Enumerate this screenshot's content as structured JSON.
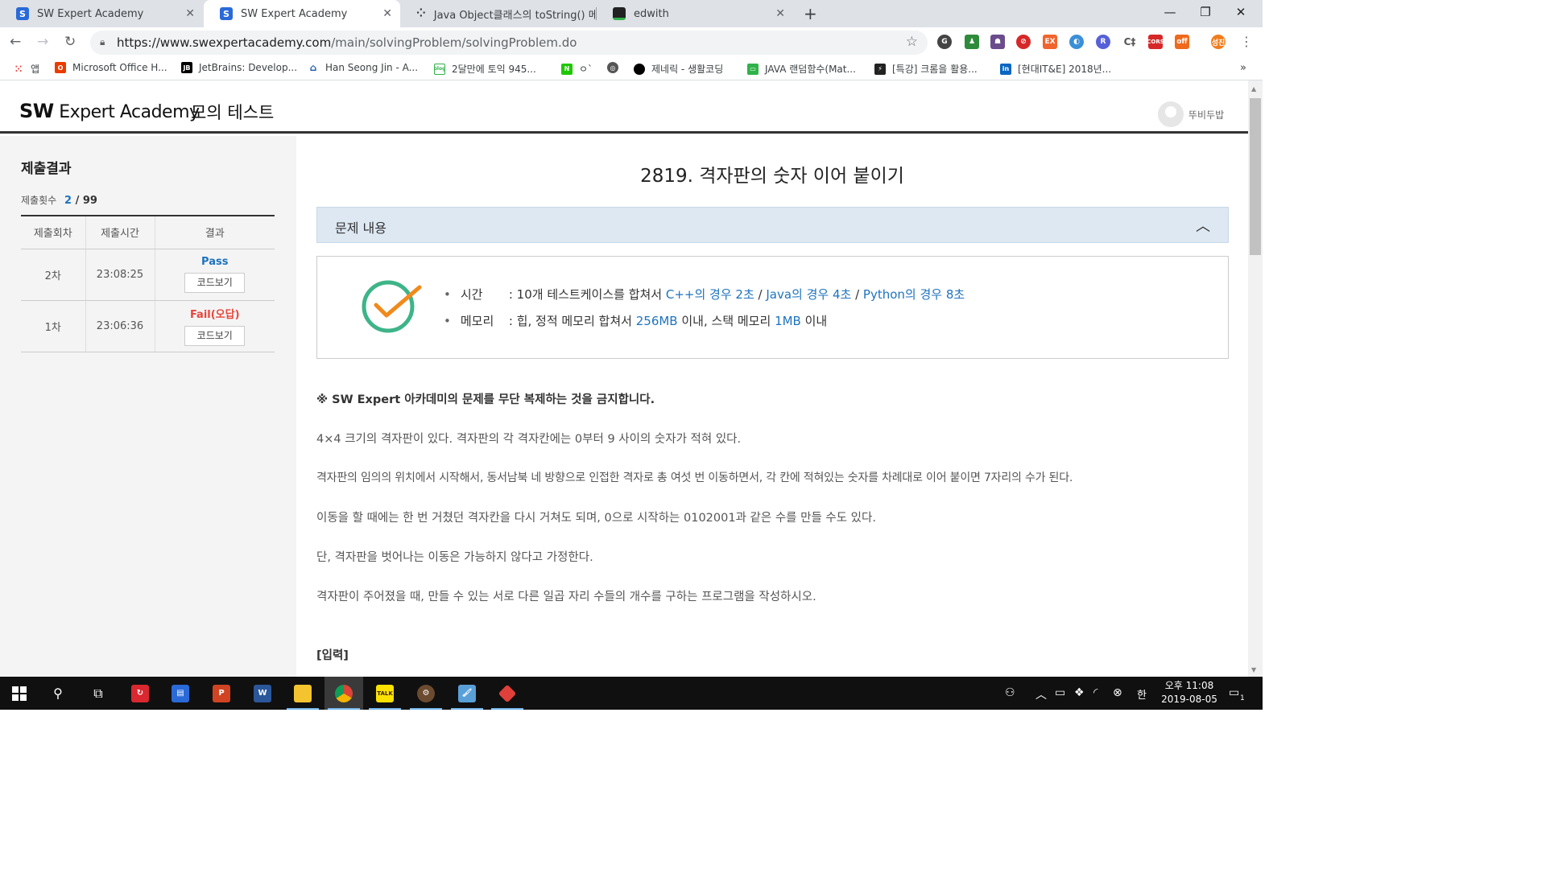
{
  "browser": {
    "tabs": [
      {
        "title": "SW Expert Academy",
        "icon": "swea-favicon"
      },
      {
        "title": "SW Expert Academy",
        "icon": "swea-favicon"
      },
      {
        "title": "Java Object클래스의 toString() 메",
        "icon": "dots-favicon"
      },
      {
        "title": "edwith",
        "icon": "edwith-favicon"
      }
    ],
    "new_tab": "+",
    "url_host": "https://www.swexpertacademy.com",
    "url_path": "/main/solvingProblem/solvingProblem.do",
    "bookmarks": [
      {
        "label": "앱",
        "icon": "apps-grid-icon"
      },
      {
        "label": "Microsoft Office H...",
        "icon": "office-icon"
      },
      {
        "label": "JetBrains: Develop...",
        "icon": "jetbrains-icon"
      },
      {
        "label": "Han Seong Jin - A...",
        "icon": "han-icon"
      },
      {
        "label": "2달만에 토익 945...",
        "icon": "blog-icon"
      },
      {
        "label": "ㅇ`",
        "icon": "naver-icon"
      },
      {
        "label": "",
        "icon": "globe-icon"
      },
      {
        "label": "제네릭 - 생활코딩",
        "icon": "opentutorials-icon"
      },
      {
        "label": "JAVA 랜덤함수(Mat...",
        "icon": "chat-icon"
      },
      {
        "label": "[특강] 크롬을 활용...",
        "icon": "lecture-icon"
      },
      {
        "label": "[현대IT&E] 2018년...",
        "icon": "linkedin-icon"
      }
    ],
    "bookmarks_more": "»"
  },
  "site": {
    "logo_bold": "SW",
    "logo_rest": "Expert Academy",
    "header_title": "모의 테스트",
    "user_name": "뚜비두밥"
  },
  "sidebar": {
    "title": "제출결과",
    "count_label": "제출횟수",
    "count_current": "2",
    "count_total": "/ 99",
    "columns": [
      "제출회차",
      "제출시간",
      "결과"
    ],
    "rows": [
      {
        "round": "2차",
        "time": "23:08:25",
        "result": "Pass",
        "button": "코드보기"
      },
      {
        "round": "1차",
        "time": "23:06:36",
        "result": "Fail(오답)",
        "button": "코드보기"
      }
    ]
  },
  "problem": {
    "title": "2819. 격자판의 숫자 이어 붙이기",
    "panel_title": "문제 내용",
    "limits": {
      "time_label": "시간",
      "time_prefix": ": 10개 테스트케이스를 합쳐서 ",
      "time_cpp": "C++의 경우 2초",
      "sep": " / ",
      "time_java": "Java의 경우 4초",
      "time_python": "Python의 경우 8초",
      "mem_label": "메모리",
      "mem_prefix": ": 힙, 정적 메모리 합쳐서 ",
      "mem_heap": "256MB",
      "mem_mid": " 이내, 스택 메모리 ",
      "mem_stack": "1MB",
      "mem_suffix": " 이내"
    },
    "notice": "※ SW Expert 아카데미의 문제를 무단 복제하는 것을 금지합니다.",
    "paragraphs": [
      "4×4 크기의 격자판이 있다. 격자판의 각 격자칸에는 0부터 9 사이의 숫자가 적혀 있다.",
      "격자판의 임의의 위치에서 시작해서, 동서남북 네 방향으로 인접한 격자로 총 여섯 번 이동하면서, 각 칸에 적혀있는 숫자를 차례대로 이어 붙이면 7자리의 수가 된다.",
      "이동을 할 때에는 한 번 거쳤던 격자칸을 다시 거쳐도 되며, 0으로 시작하는 0102001과 같은 수를 만들 수도 있다.",
      "단, 격자판을 벗어나는 이동은 가능하지 않다고 가정한다.",
      "격자판이 주어졌을 때, 만들 수 있는 서로 다른 일곱 자리 수들의 개수를 구하는 프로그램을 작성하시오."
    ],
    "input_heading": "[입력]"
  },
  "taskbar": {
    "clock_time": "오후 11:08",
    "clock_date": "2019-08-05",
    "ime": "한",
    "notifications": "1"
  },
  "colors": {
    "accent_blue": "#1e73be",
    "fail_red": "#e8463b",
    "check_green": "#3eb489",
    "check_orange": "#f08a1c"
  }
}
